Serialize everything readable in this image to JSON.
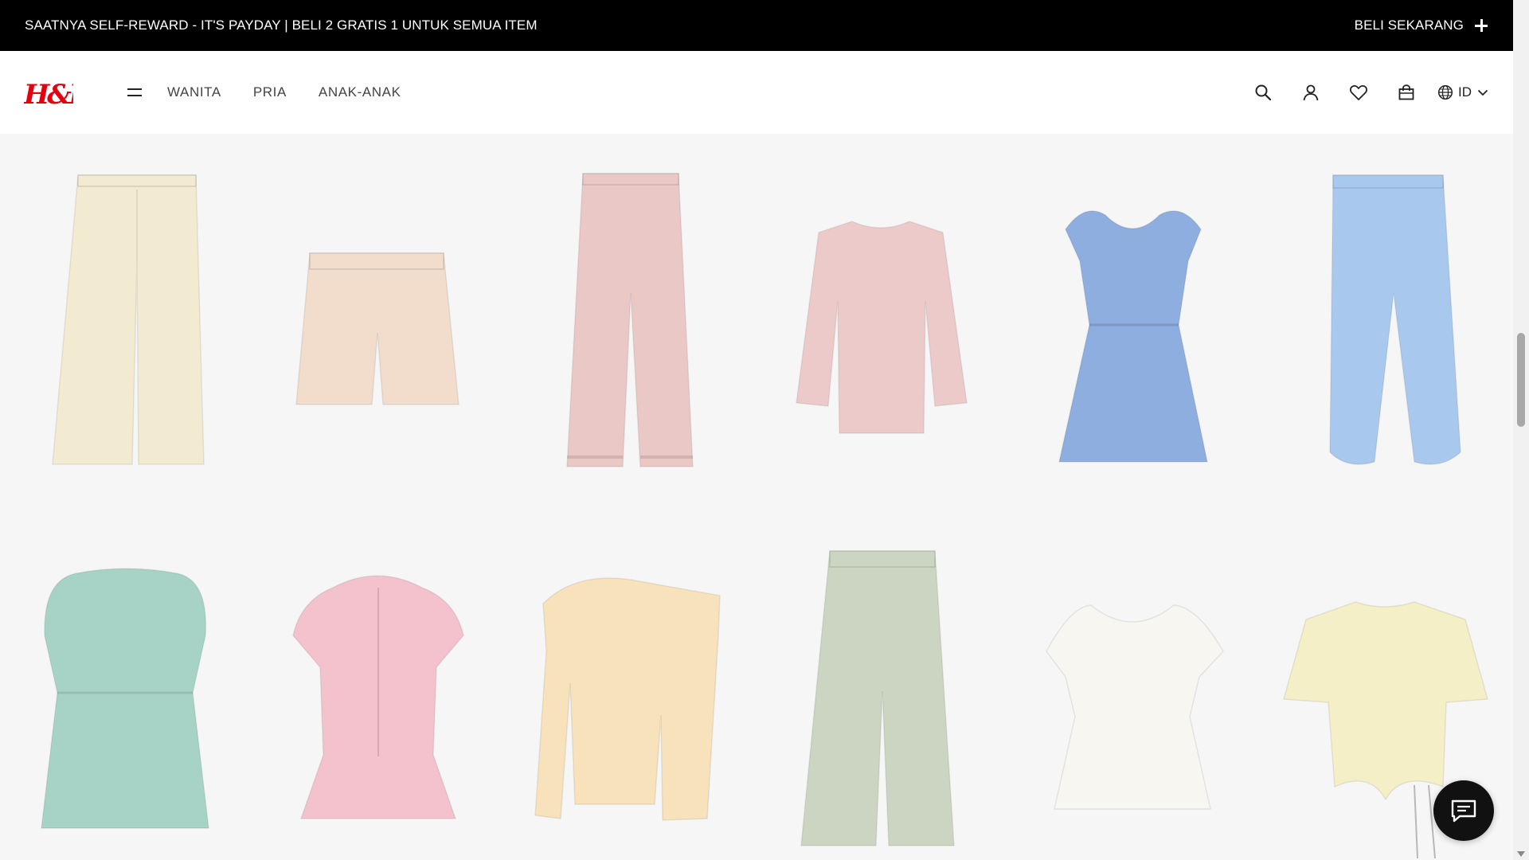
{
  "promo": {
    "text": "SAATNYA SELF-REWARD - IT'S PAYDAY | BELI 2 GRATIS 1 UNTUK SEMUA ITEM",
    "cta": "BELI SEKARANG"
  },
  "header": {
    "logo": "H&M",
    "nav": [
      "WANITA",
      "PRIA",
      "ANAK-ANAK"
    ],
    "language": "ID",
    "icons": [
      "menu-icon",
      "search-icon",
      "account-icon",
      "heart-icon",
      "bag-icon",
      "globe-icon",
      "chevron-down-icon"
    ]
  },
  "colors": {
    "brand_red": "#e50010",
    "banner": "#000000",
    "grid_bg": "#f6f6f6",
    "products": [
      "#f3ead2",
      "#f2dccc",
      "#eac8c6",
      "#edcaca",
      "#8eaee0",
      "#a9c8ee",
      "#a7d3c6",
      "#f4c2cd",
      "#f8e2bc",
      "#cbd5c1",
      "#f7f6f1",
      "#f4efc6"
    ]
  },
  "products": [
    {
      "type": "pants",
      "color": "#f3ead2"
    },
    {
      "type": "shorts",
      "color": "#f2dccc"
    },
    {
      "type": "flare-pants",
      "color": "#eac8c6"
    },
    {
      "type": "long-sleeve-top",
      "color": "#edcaca"
    },
    {
      "type": "puff-dress",
      "color": "#8eaee0"
    },
    {
      "type": "jogger-pants",
      "color": "#a9c8ee"
    },
    {
      "type": "peplum-top",
      "color": "#a7d3c6"
    },
    {
      "type": "peplum-cardigan",
      "color": "#f4c2cd"
    },
    {
      "type": "off-shoulder-top",
      "color": "#f8e2bc"
    },
    {
      "type": "wide-pants",
      "color": "#cbd5c1"
    },
    {
      "type": "blouse",
      "color": "#f7f6f1"
    },
    {
      "type": "tee",
      "color": "#f4efc6"
    }
  ]
}
